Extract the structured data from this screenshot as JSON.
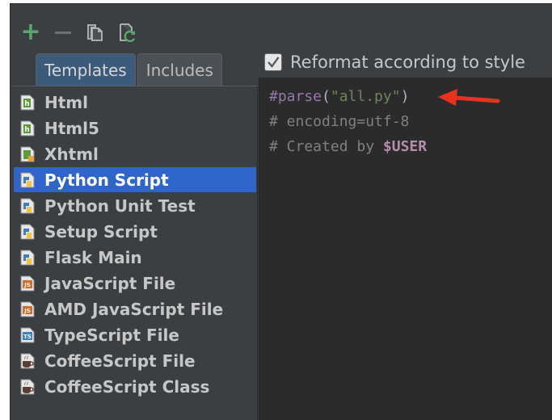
{
  "toolbar": {
    "add_icon": "plus-icon",
    "remove_icon": "minus-icon",
    "copy_icon": "copy-icon",
    "reset_icon": "reset-icon"
  },
  "tabs": [
    {
      "label": "Templates",
      "active": true
    },
    {
      "label": "Includes",
      "active": false
    }
  ],
  "templates": [
    {
      "label": "Html",
      "icon": "html-file-icon",
      "selected": false
    },
    {
      "label": "Html5",
      "icon": "html-file-icon",
      "selected": false
    },
    {
      "label": "Xhtml",
      "icon": "xhtml-file-icon",
      "selected": false
    },
    {
      "label": "Python Script",
      "icon": "python-file-icon",
      "selected": true
    },
    {
      "label": "Python Unit Test",
      "icon": "python-file-icon",
      "selected": false
    },
    {
      "label": "Setup Script",
      "icon": "python-file-icon",
      "selected": false
    },
    {
      "label": "Flask Main",
      "icon": "python-file-icon",
      "selected": false
    },
    {
      "label": "JavaScript File",
      "icon": "javascript-file-icon",
      "selected": false
    },
    {
      "label": "AMD JavaScript File",
      "icon": "javascript-file-icon",
      "selected": false
    },
    {
      "label": "TypeScript File",
      "icon": "typescript-file-icon",
      "selected": false
    },
    {
      "label": "CoffeeScript File",
      "icon": "coffeescript-file-icon",
      "selected": false
    },
    {
      "label": "CoffeeScript Class",
      "icon": "coffeescript-file-icon",
      "selected": false
    }
  ],
  "reformat": {
    "label": "Reformat according to style",
    "checked": true
  },
  "editor": {
    "line1": {
      "directive": "#parse",
      "open": "(",
      "string": "\"all.py\"",
      "close": ")"
    },
    "line2": "# encoding=utf-8",
    "line3": {
      "prefix": "# Created by ",
      "variable": "$USER"
    }
  },
  "colors": {
    "selection": "#2f65ca",
    "annotation_arrow": "#e8321e"
  }
}
